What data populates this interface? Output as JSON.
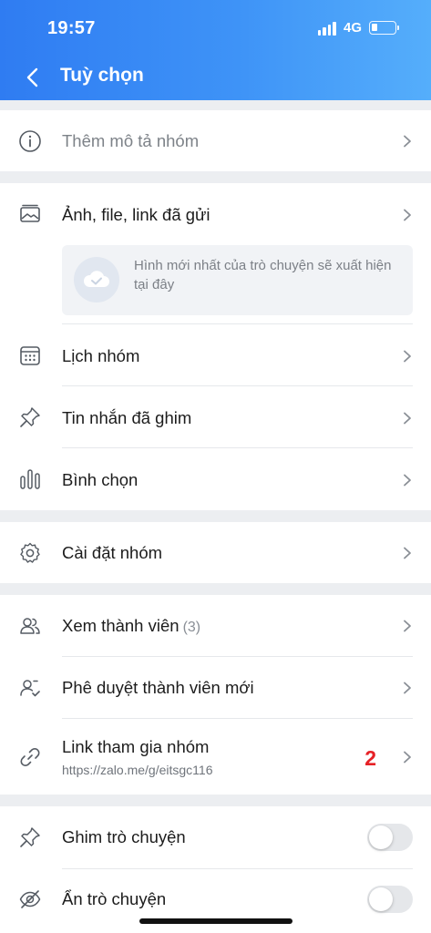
{
  "status": {
    "time": "19:57",
    "network": "4G"
  },
  "header": {
    "title": "Tuỳ chọn"
  },
  "group_description": {
    "label": "Thêm mô tả nhóm"
  },
  "media": {
    "label": "Ảnh, file, link đã gửi",
    "empty_text": "Hình mới nhất của trò chuyện sẽ xuất hiện tại đây"
  },
  "items": {
    "calendar": "Lịch nhóm",
    "pinned": "Tin nhắn đã ghim",
    "poll": "Bình chọn",
    "settings": "Cài đặt nhóm",
    "members": "Xem thành viên",
    "members_count": "(3)",
    "approve": "Phê duyệt thành viên mới",
    "join_link": "Link tham gia nhóm",
    "join_link_url": "https://zalo.me/g/eitsgc116",
    "join_link_badge": "2",
    "pin_chat": "Ghim trò chuyện",
    "hide_chat": "Ẩn trò chuyện"
  },
  "toggles": {
    "pin_chat": false,
    "hide_chat": false
  },
  "colors": {
    "header_start": "#2f7cf2",
    "header_end": "#55aefb",
    "badge": "#e62126",
    "background": "#eceef1"
  }
}
